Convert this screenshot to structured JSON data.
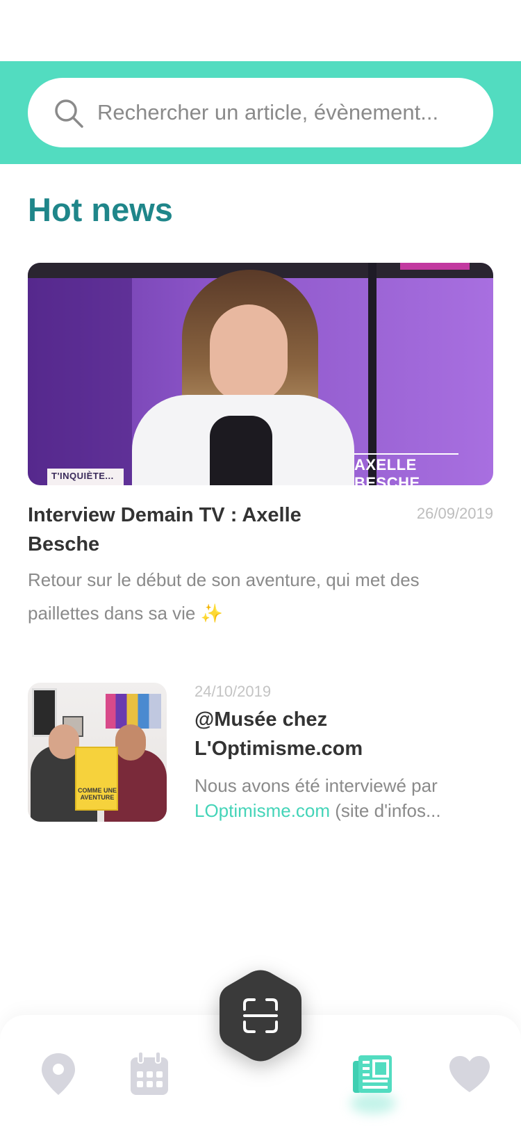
{
  "search": {
    "placeholder": "Rechercher un article, évènement..."
  },
  "section": {
    "title": "Hot news"
  },
  "hero": {
    "title": "Interview Demain TV : Axelle Besche",
    "date": "26/09/2019",
    "description": "Retour sur le début de son aventure, qui met des paillettes dans sa vie ✨",
    "image_caption": "AXELLE BESCHE @MUSÉE",
    "image_tag": "T'INQUIÈTE..."
  },
  "articles": [
    {
      "date": "24/10/2019",
      "title": "@Musée chez L'Optimisme.com",
      "desc_prefix": "Nous avons été interviewé par ",
      "desc_link": "LOptimisme.com",
      "desc_suffix": " (site d'infos...",
      "thumb_poster_text": "COMME UNE AVENTURE"
    }
  ],
  "nav": {
    "items": [
      {
        "name": "map",
        "icon": "map-pin-icon",
        "active": false
      },
      {
        "name": "calendar",
        "icon": "calendar-icon",
        "active": false
      },
      {
        "name": "scan",
        "icon": "scan-icon",
        "active": false
      },
      {
        "name": "news",
        "icon": "newspaper-icon",
        "active": true
      },
      {
        "name": "favorites",
        "icon": "heart-icon",
        "active": false
      }
    ]
  },
  "colors": {
    "accent": "#52dcc0",
    "title": "#1f868a",
    "nav_inactive": "#d6d6de",
    "scan_button": "#3a3a3a"
  }
}
